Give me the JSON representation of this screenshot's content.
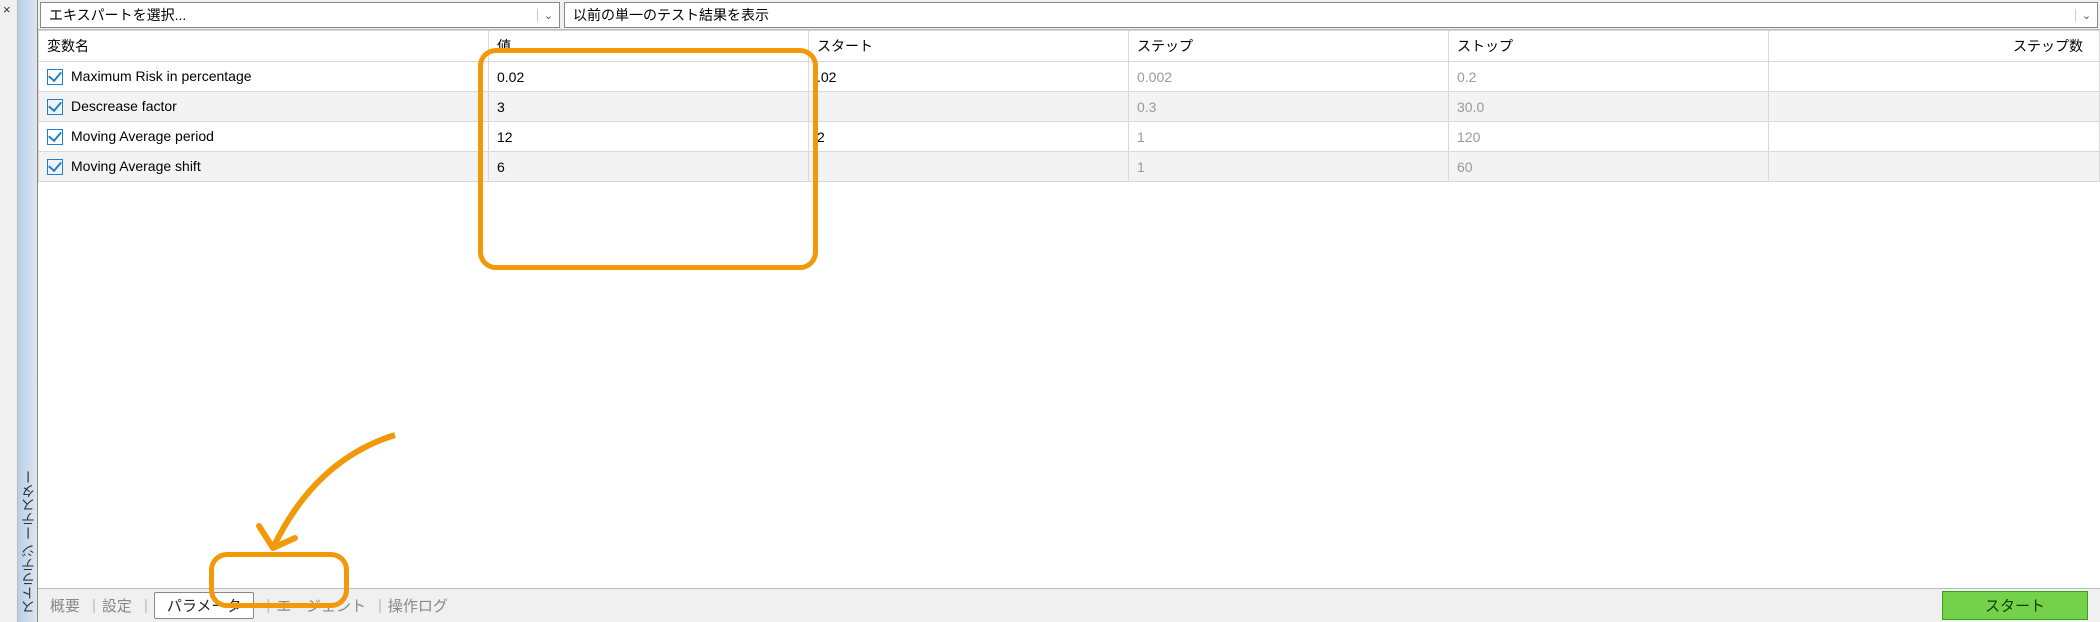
{
  "side_title": "ストラテジ ーテスター",
  "close_glyph": "×",
  "top": {
    "expert_select": "エキスパートを選択...",
    "prev_results": "以前の単一のテスト結果を表示"
  },
  "columns": {
    "name": "変数名",
    "value": "値",
    "start": "スタート",
    "step": "ステップ",
    "stop": "ストップ",
    "steps": "ステップ数"
  },
  "rows": [
    {
      "name": "Maximum Risk in percentage",
      "value": "0.02",
      "start": ".02",
      "step": "0.002",
      "stop": "0.2",
      "dimStart": false,
      "dimStep": true,
      "dimStop": true,
      "even": false
    },
    {
      "name": "Descrease factor",
      "value": "3",
      "start": "",
      "step": "0.3",
      "stop": "30.0",
      "dimStart": false,
      "dimStep": true,
      "dimStop": true,
      "even": true
    },
    {
      "name": "Moving Average period",
      "value": "12",
      "start": "2",
      "step": "1",
      "stop": "120",
      "dimStart": false,
      "dimStep": true,
      "dimStop": true,
      "even": false
    },
    {
      "name": "Moving Average shift",
      "value": "6",
      "start": "",
      "step": "1",
      "stop": "60",
      "dimStart": false,
      "dimStep": true,
      "dimStop": true,
      "even": true
    }
  ],
  "tabs": {
    "overview": "概要",
    "settings": "設定",
    "parameters": "パラメータ",
    "agents": "エージェント",
    "log": "操作ログ"
  },
  "start_button": "スタート",
  "chevron": "⌄"
}
